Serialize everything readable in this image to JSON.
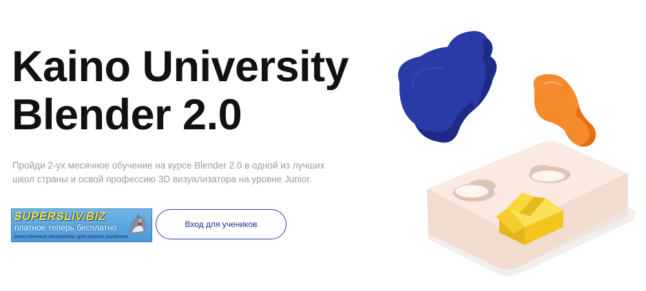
{
  "hero": {
    "title_line1": "Kaino University",
    "title_line2": "Blender 2.0",
    "description": "Пройди 2-ух месячное обучение на курсе Blender 2.0 в одной из лучших школ страны и освой профессию 3D визуализатора на уровне Junior."
  },
  "banner": {
    "brand": "SUPERSLIV.BIZ",
    "tagline": "платное теперь бесплатно",
    "subtitle": "качественные материалы для вашего развития"
  },
  "actions": {
    "login_label": "Вход для учеников"
  },
  "colors": {
    "accent": "#2b3bb5",
    "title": "#111111",
    "description": "#9a9aa0",
    "blob_blue": "#2a3aa6",
    "blob_orange": "#f58a2c",
    "house_yellow": "#f5cf2a",
    "board": "#f7e4da"
  },
  "illustration": {
    "icons": [
      "blue-blob-icon",
      "orange-bulb-icon",
      "puzzle-board-icon",
      "house-piece-icon"
    ]
  }
}
